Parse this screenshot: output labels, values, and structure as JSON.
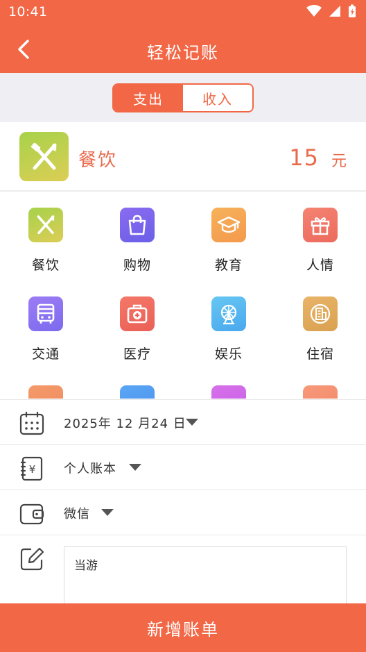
{
  "status": {
    "time": "10:41"
  },
  "appbar": {
    "title": "轻松记账"
  },
  "segment": {
    "expense": "支出",
    "income": "收入",
    "active": "expense"
  },
  "selected": {
    "label": "餐饮",
    "amount": "15",
    "unit": "元"
  },
  "categories": [
    {
      "label": "餐饮",
      "icon": "fork-knife-icon",
      "color_a": "#a6d24b",
      "color_b": "#dccd56"
    },
    {
      "label": "购物",
      "icon": "shopping-bag-icon",
      "color_a": "#8a6bf0",
      "color_b": "#6b5fe8"
    },
    {
      "label": "教育",
      "icon": "graduation-cap-icon",
      "color_a": "#f7b15a",
      "color_b": "#f39a4c"
    },
    {
      "label": "人情",
      "icon": "gift-icon",
      "color_a": "#f58372",
      "color_b": "#ec6a5e"
    },
    {
      "label": "交通",
      "icon": "bus-icon",
      "color_a": "#9d7cf5",
      "color_b": "#7b6bee"
    },
    {
      "label": "医疗",
      "icon": "medical-kit-icon",
      "color_a": "#f47868",
      "color_b": "#ea5f57"
    },
    {
      "label": "娱乐",
      "icon": "ferris-wheel-icon",
      "color_a": "#66c7f2",
      "color_b": "#4aa8ee"
    },
    {
      "label": "住宿",
      "icon": "building-icon",
      "color_a": "#e9b469",
      "color_b": "#d9a150"
    },
    {
      "label": "",
      "icon": "partial-icon",
      "color_a": "#f49a6a",
      "color_b": "#f08a5e"
    },
    {
      "label": "",
      "icon": "partial-icon",
      "color_a": "#5aa7f4",
      "color_b": "#4b8ef0"
    },
    {
      "label": "",
      "icon": "partial-icon",
      "color_a": "#d870ea",
      "color_b": "#c45fe5"
    },
    {
      "label": "",
      "icon": "partial-icon",
      "color_a": "#f79a7a",
      "color_b": "#f18466"
    }
  ],
  "form": {
    "date": "2025年 12 月24 日",
    "book": "个人账本",
    "account": "微信",
    "note": "当游"
  },
  "submit": {
    "label": "新增账单"
  },
  "colors": {
    "accent": "#f26745",
    "text_accent": "#e86b4d"
  }
}
